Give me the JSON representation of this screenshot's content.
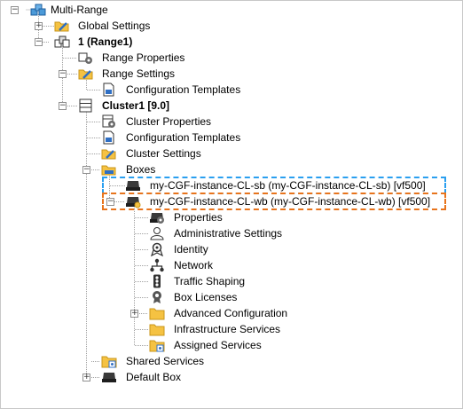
{
  "tree": {
    "root": {
      "label": "Multi-Range"
    },
    "global_settings": {
      "label": "Global Settings"
    },
    "range": {
      "label": "1 (Range1)"
    },
    "range_properties": {
      "label": "Range Properties"
    },
    "range_settings": {
      "label": "Range Settings"
    },
    "range_config_templates": {
      "label": "Configuration Templates"
    },
    "cluster": {
      "label": "Cluster1 [9.0]"
    },
    "cluster_properties": {
      "label": "Cluster Properties"
    },
    "cluster_config_templates": {
      "label": "Configuration Templates"
    },
    "cluster_settings": {
      "label": "Cluster Settings"
    },
    "boxes": {
      "label": "Boxes"
    },
    "box_sb": {
      "label": "my-CGF-instance-CL-sb (my-CGF-instance-CL-sb) [vf500]"
    },
    "box_wb": {
      "label": "my-CGF-instance-CL-wb (my-CGF-instance-CL-wb) [vf500]"
    },
    "box_properties": {
      "label": "Properties"
    },
    "admin_settings": {
      "label": "Administrative Settings"
    },
    "identity": {
      "label": "Identity"
    },
    "network": {
      "label": "Network"
    },
    "traffic_shaping": {
      "label": "Traffic Shaping"
    },
    "box_licenses": {
      "label": "Box Licenses"
    },
    "advanced_configuration": {
      "label": "Advanced Configuration"
    },
    "infrastructure_services": {
      "label": "Infrastructure Services"
    },
    "assigned_services": {
      "label": "Assigned Services"
    },
    "shared_services": {
      "label": "Shared Services"
    },
    "default_box": {
      "label": "Default Box"
    }
  },
  "highlight_colors": {
    "sb": "#2a9ff0",
    "wb": "#e8741c"
  }
}
